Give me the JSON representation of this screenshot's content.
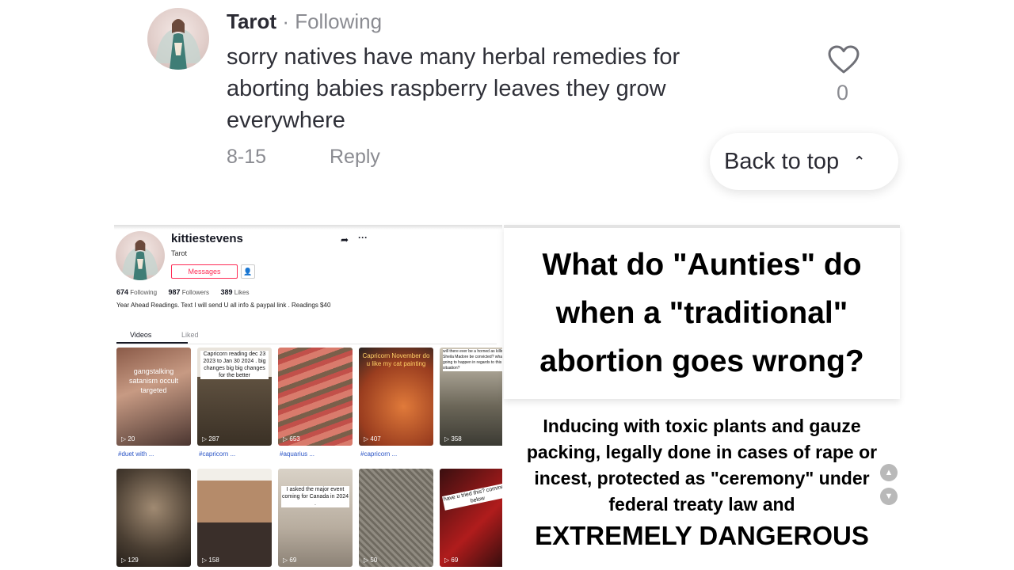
{
  "comment": {
    "author": "Tarot",
    "separator": "·",
    "following_label": "Following",
    "text": "sorry natives have many herbal remedies for aborting babies raspberry leaves they grow everywhere",
    "date": "8-15",
    "reply_label": "Reply",
    "like_count": "0",
    "back_to_top_label": "Back to top",
    "back_to_top_icon": "⌃"
  },
  "profile": {
    "username": "kittiestevens",
    "nickname": "Tarot",
    "messages_label": "Messages",
    "following_count": "674",
    "following_label": "Following",
    "followers_count": "987",
    "followers_label": "Followers",
    "likes_count": "389",
    "likes_label": "Likes",
    "bio": "Year Ahead Readings. Text I will send U all info & paypal link . Readings $40",
    "tabs": [
      "Videos",
      "Liked"
    ],
    "videos_row1": [
      {
        "views": "20",
        "overlay": "gangstalking satanism occult targeted",
        "caption": "#duet with ..."
      },
      {
        "views": "287",
        "overlay": "Capricorn reading dec 23 2023 to Jan 30 2024 . big changes big big changes for the better",
        "caption": "#capricorn ..."
      },
      {
        "views": "653",
        "overlay": "",
        "caption": "#aquarius ..."
      },
      {
        "views": "407",
        "overlay": "Capricorn November do u like my cat painting",
        "caption": "#capricorn ..."
      },
      {
        "views": "358",
        "overlay": "will there ever be a horned as killing Sheila Madore be convicted? what is going to happen in regards to this situation?",
        "caption": ""
      }
    ],
    "videos_row2": [
      {
        "views": "129",
        "overlay": ""
      },
      {
        "views": "158",
        "overlay": ""
      },
      {
        "views": "69",
        "overlay": "I asked the major event coming for Canada in 2024 ."
      },
      {
        "views": "50",
        "overlay": ""
      },
      {
        "views": "69",
        "overlay": "have u tried this? comment below"
      }
    ]
  },
  "panel": {
    "title": "What do \"Aunties\" do when a \"traditional\" abortion goes wrong?",
    "body": "Inducing with toxic plants and gauze packing, legally done in cases of rape or incest, protected as \"ceremony\" under federal treaty law and",
    "warning": "EXTREMELY DANGEROUS"
  }
}
